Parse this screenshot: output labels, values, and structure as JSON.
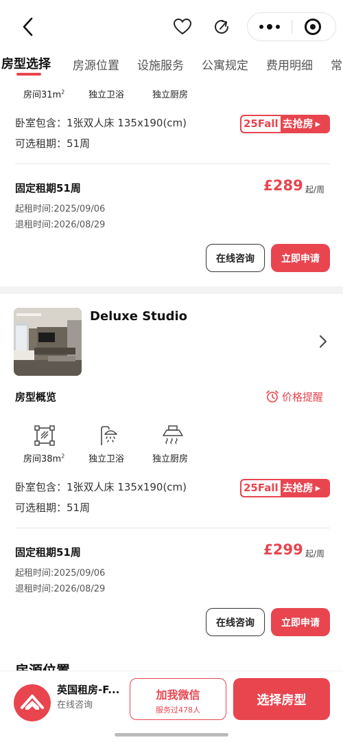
{
  "nav": {
    "tabs": [
      "房型选择",
      "房源位置",
      "设施服务",
      "公寓规定",
      "费用明细",
      "常见"
    ]
  },
  "room1": {
    "features": [
      "房间31m",
      "独立卫浴",
      "独立厨房"
    ],
    "bedroom": "卧室包含：1张双人床 135x190(cm)",
    "terms": "可选租期：51周",
    "badge": {
      "left": "25Fall",
      "right": "去抢房"
    },
    "lease_title": "固定租期51周",
    "price_currency": "£",
    "price": "289",
    "price_unit": "起/周",
    "start_date": "起租时间:2025/09/06",
    "end_date": "退租时间:2026/08/29",
    "consult": "在线咨询",
    "apply": "立即申请"
  },
  "room2": {
    "name": "Deluxe Studio",
    "overview": "房型概览",
    "price_alert": "价格提醒",
    "features": [
      "房间38m",
      "独立卫浴",
      "独立厨房"
    ],
    "bedroom": "卧室包含：1张双人床 135x190(cm)",
    "terms": "可选租期：51周",
    "badge": {
      "left": "25Fall",
      "right": "去抢房"
    },
    "lease_title": "固定租期51周",
    "price_currency": "£",
    "price": "299",
    "price_unit": "起/周",
    "start_date": "起租时间:2025/09/06",
    "end_date": "退租时间:2026/08/29",
    "consult": "在线咨询",
    "apply": "立即申请"
  },
  "next_section_title": "房源位置",
  "footer": {
    "brand_name": "英国租房-F...",
    "brand_sub": "在线咨询",
    "wechat_label": "加我微信",
    "wechat_sub": "服务过478人",
    "choose_label": "选择房型"
  },
  "colors": {
    "accent": "#e8454f"
  }
}
